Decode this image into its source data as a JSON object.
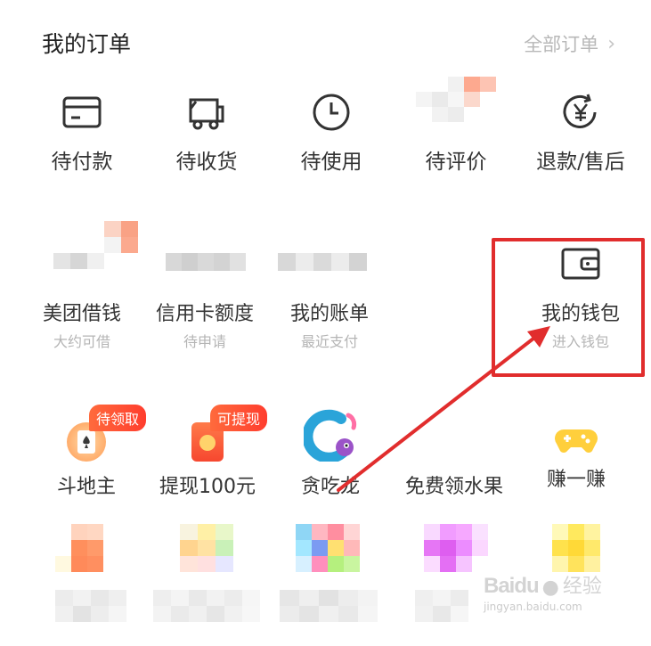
{
  "header": {
    "title": "我的订单",
    "all_orders_label": "全部订单",
    "chevron": "›"
  },
  "orders": [
    {
      "label": "待付款",
      "icon": "card-icon"
    },
    {
      "label": "待收货",
      "icon": "truck-icon"
    },
    {
      "label": "待使用",
      "icon": "clock-icon"
    },
    {
      "label": "待评价",
      "icon": "pixelated-icon"
    },
    {
      "label": "退款/售后",
      "icon": "yen-refresh-icon"
    }
  ],
  "services": [
    {
      "label": "美团借钱",
      "sub": "大约可借"
    },
    {
      "label": "信用卡额度",
      "sub": "待申请"
    },
    {
      "label": "我的账单",
      "sub": "最近支付"
    },
    {
      "label": "我的钱包",
      "sub": "进入钱包",
      "icon": "wallet-icon"
    }
  ],
  "games": [
    {
      "label": "斗地主",
      "badge": "待领取",
      "icon": "poker-icon"
    },
    {
      "label": "提现100元",
      "badge": "可提现",
      "icon": "red-envelope-icon"
    },
    {
      "label": "贪吃龙",
      "icon": "dragon-icon"
    },
    {
      "label": "免费领水果",
      "icon": "fruit-icon"
    },
    {
      "label": "赚一赚",
      "icon": "gamepad-icon"
    }
  ],
  "watermark": {
    "brand": "Baidu",
    "cn": "经验",
    "url": "jingyan.baidu.com"
  },
  "colors": {
    "accent_red": "#e12d2d",
    "badge_orange": "#ff5533",
    "text": "#333333",
    "muted": "#b5b5b5"
  }
}
